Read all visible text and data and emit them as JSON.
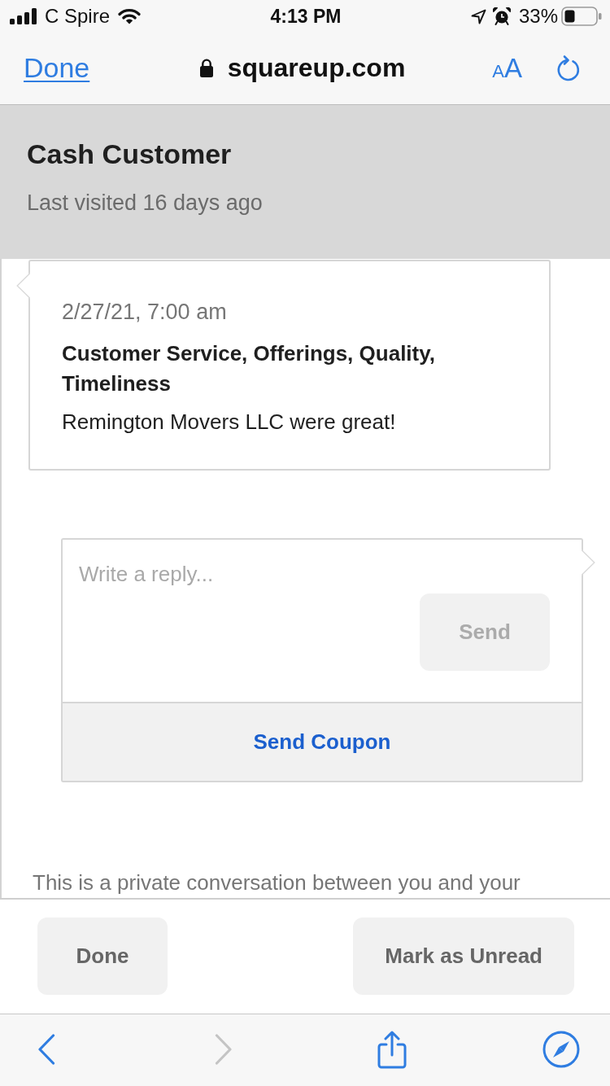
{
  "status_bar": {
    "carrier": "C Spire",
    "time": "4:13 PM",
    "battery": "33%"
  },
  "browser_bar": {
    "done_link": "Done",
    "domain": "squareup.com",
    "text_size_button": "AA"
  },
  "header": {
    "title": "Cash Customer",
    "subtitle": "Last visited 16 days ago"
  },
  "review": {
    "date": "2/27/21, 7:00 am",
    "topics": "Customer Service, Offerings, Quality, Timeliness",
    "comment": "Remington Movers LLC were great!"
  },
  "reply": {
    "placeholder": "Write a reply...",
    "send_button": {
      "label": "Send",
      "disabled": true
    },
    "coupon_button": "Send Coupon"
  },
  "privacy_note": "This is a private conversation between you and your",
  "footer": {
    "buttons": [
      "Done",
      "Mark as Unread"
    ]
  },
  "toolbar": {
    "items": [
      {
        "kind": "back",
        "disabled": false
      },
      {
        "kind": "forward",
        "disabled": true
      },
      {
        "kind": "share",
        "disabled": false
      },
      {
        "kind": "compass",
        "disabled": false
      }
    ]
  }
}
